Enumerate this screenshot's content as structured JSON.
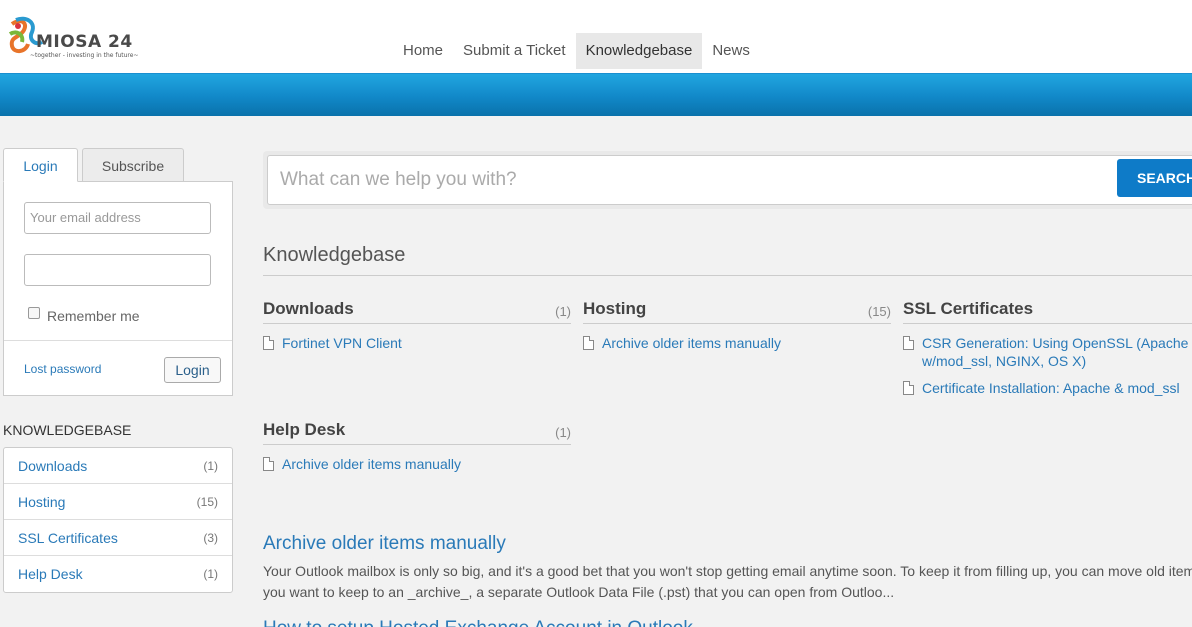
{
  "brand": {
    "name": "MIOSA 24",
    "tagline": "~together - investing in the future~",
    "colors": {
      "blue": "#1188c8",
      "link": "#2a7ab8"
    }
  },
  "nav": {
    "items": [
      "Home",
      "Submit a Ticket",
      "Knowledgebase",
      "News"
    ],
    "active": "Knowledgebase"
  },
  "login": {
    "tabs": [
      "Login",
      "Subscribe"
    ],
    "email_placeholder": "Your email address",
    "password_value": "",
    "remember_label": "Remember me",
    "lost_password": "Lost password",
    "button": "Login"
  },
  "sidebar_kb": {
    "heading": "KNOWLEDGEBASE",
    "items": [
      {
        "label": "Downloads",
        "count": "(1)"
      },
      {
        "label": "Hosting",
        "count": "(15)"
      },
      {
        "label": "SSL Certificates",
        "count": "(3)"
      },
      {
        "label": "Help Desk",
        "count": "(1)"
      }
    ]
  },
  "search": {
    "placeholder": "What can we help you with?",
    "button": "SEARCH"
  },
  "main": {
    "title": "Knowledgebase",
    "categories": [
      {
        "name": "Downloads",
        "count": "(1)",
        "articles": [
          "Fortinet VPN Client"
        ]
      },
      {
        "name": "Hosting",
        "count": "(15)",
        "articles": [
          "Archive older items manually"
        ]
      },
      {
        "name": "SSL Certificates",
        "count": "",
        "articles": [
          "CSR Generation: Using OpenSSL (Apache w/mod_ssl, NGINX, OS X)",
          "Certificate Installation: Apache & mod_ssl"
        ]
      },
      {
        "name": "Help Desk",
        "count": "(1)",
        "articles": [
          "Archive older items manually"
        ]
      }
    ],
    "featured": {
      "title": "Archive older items manually",
      "excerpt": "Your Outlook mailbox is only so big, and it's a good bet that you won't stop getting email anytime soon. To keep it from filling up, you can move old items you want to keep to an _archive_, a separate Outlook Data File (.pst) that you can open from Outloo...",
      "next_title": "How to setup Hosted Exchange Account in Outlook"
    }
  }
}
